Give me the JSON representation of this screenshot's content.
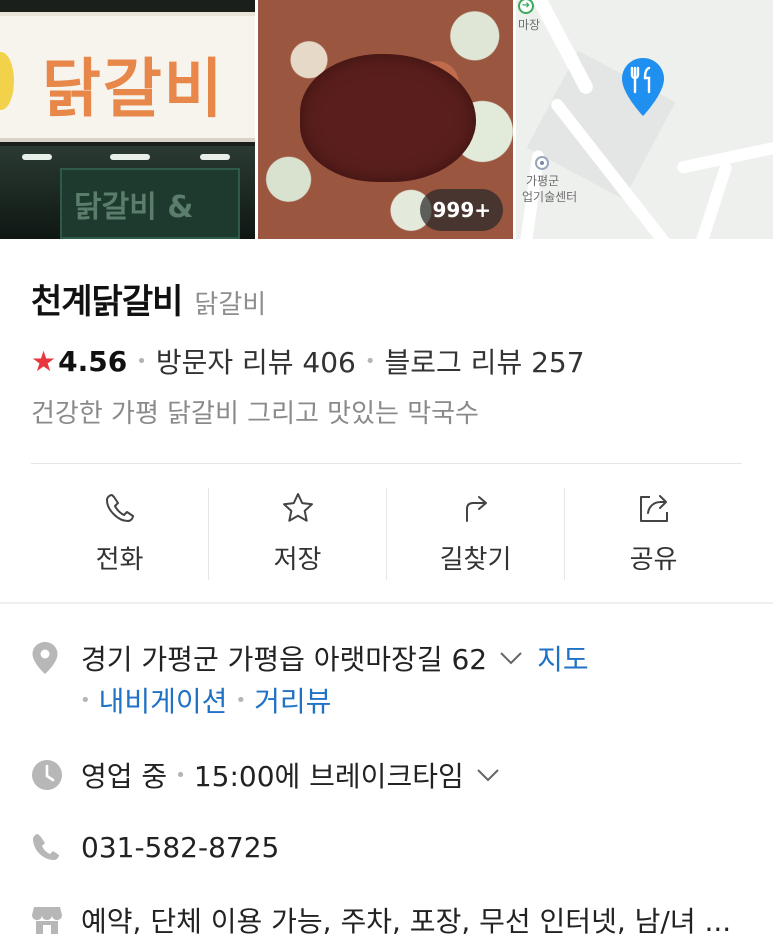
{
  "photos": {
    "sign_text": "닭갈비",
    "store_sign_text": "닭갈비 &",
    "count_badge": "999+",
    "map": {
      "label_top": "마장",
      "label_poi_line1": "가평군",
      "label_poi_line2": "업기술센터"
    }
  },
  "place": {
    "name": "천계닭갈비",
    "category": "닭갈비",
    "rating": "4.56",
    "visitor_reviews": "방문자 리뷰 406",
    "blog_reviews": "블로그 리뷰 257",
    "tagline": "건강한 가평 닭갈비 그리고 맛있는 막국수"
  },
  "actions": [
    {
      "label": "전화",
      "icon": "phone-icon"
    },
    {
      "label": "저장",
      "icon": "star-icon"
    },
    {
      "label": "길찾기",
      "icon": "directions-icon"
    },
    {
      "label": "공유",
      "icon": "share-icon"
    }
  ],
  "details": {
    "address": "경기 가평군 가평읍 아랫마장길 62",
    "map_link": "지도",
    "navigation_link": "내비게이션",
    "street_view_link": "거리뷰",
    "status": "영업 중",
    "hours": "15:00에 브레이크타임",
    "phone": "031-582-8725",
    "amenities": "예약, 단체 이용 가능, 주차, 포장, 무선 인터넷, 남/녀 ..."
  },
  "colors": {
    "accent_star": "#e9353c",
    "link": "#1f72c6",
    "map_pin": "#1f8ff0"
  }
}
